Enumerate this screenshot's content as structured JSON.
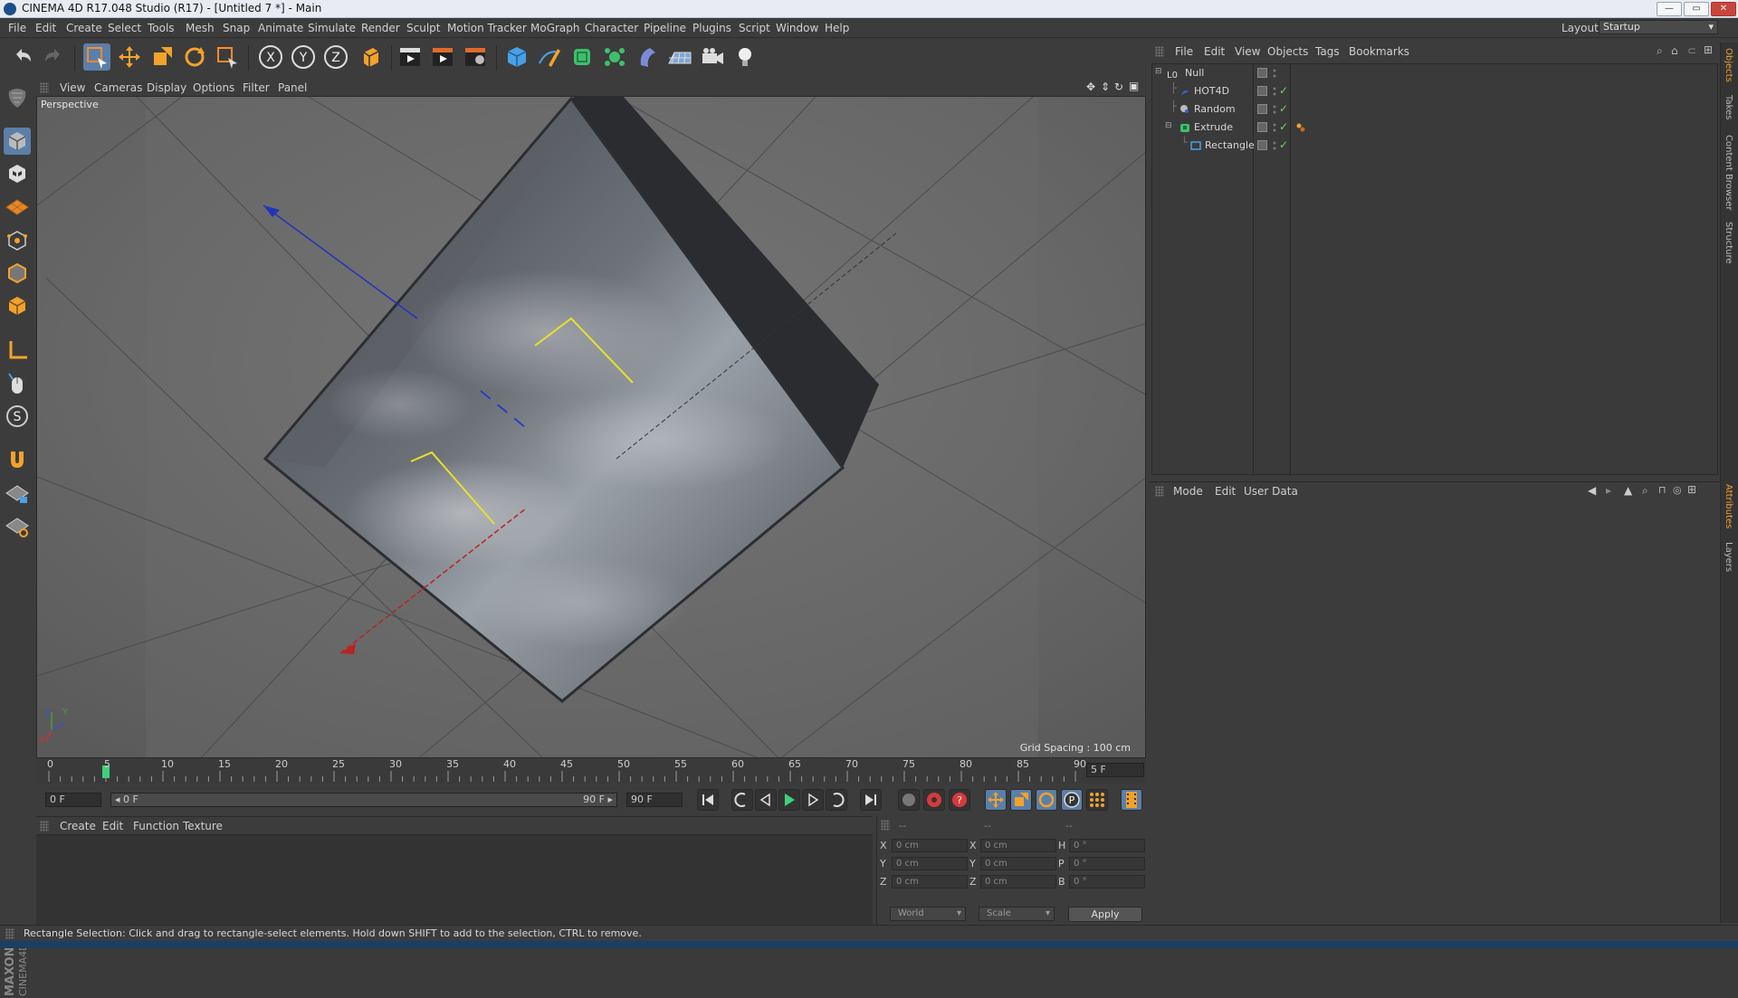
{
  "window": {
    "title": "CINEMA 4D R17.048 Studio (R17) - [Untitled 7 *] - Main",
    "minimize": "—",
    "maximize": "▭",
    "close": "✕"
  },
  "menu": {
    "items": [
      "File",
      "Edit",
      "Create",
      "Select",
      "Tools",
      "Mesh",
      "Snap",
      "Animate",
      "Simulate",
      "Render",
      "Sculpt",
      "Motion Tracker",
      "MoGraph",
      "Character",
      "Pipeline",
      "Plugins",
      "Script",
      "Window",
      "Help"
    ],
    "layout_label": "Layout:",
    "layout_value": "Startup"
  },
  "viewport": {
    "menu": [
      "View",
      "Cameras",
      "Display",
      "Options",
      "Filter",
      "Panel"
    ],
    "camera_label": "Perspective",
    "grid_spacing": "Grid Spacing : 100 cm",
    "axis_labels": {
      "y": "Y",
      "z": "Z",
      "x": "X"
    }
  },
  "timeline": {
    "ticks": [
      "0",
      "5",
      "10",
      "15",
      "20",
      "25",
      "30",
      "35",
      "40",
      "45",
      "50",
      "55",
      "60",
      "65",
      "70",
      "75",
      "80",
      "85",
      "90"
    ],
    "current_frame_display": "5 F",
    "start_field": "0 F",
    "range_start": "◂ 0 F",
    "range_end": "90 F ▸",
    "end_field": "90 F"
  },
  "material_manager": {
    "menu": [
      "Create",
      "Edit",
      "Function",
      "Texture"
    ]
  },
  "coordinates": {
    "headers": [
      "--",
      "--",
      "--"
    ],
    "rows": [
      {
        "a_label": "X",
        "a_value": "0 cm",
        "b_label": "X",
        "b_value": "0 cm",
        "c_label": "H",
        "c_value": "0 °"
      },
      {
        "a_label": "Y",
        "a_value": "0 cm",
        "b_label": "Y",
        "b_value": "0 cm",
        "c_label": "P",
        "c_value": "0 °"
      },
      {
        "a_label": "Z",
        "a_value": "0 cm",
        "b_label": "Z",
        "b_value": "0 cm",
        "c_label": "B",
        "c_value": "0 °"
      }
    ],
    "space": "World",
    "mode": "Scale",
    "apply": "Apply"
  },
  "status": "Rectangle Selection: Click and drag to rectangle-select elements. Hold down SHIFT to add to the selection, CTRL to remove.",
  "object_manager": {
    "menu": [
      "File",
      "Edit",
      "View",
      "Objects",
      "Tags",
      "Bookmarks"
    ],
    "objects": [
      {
        "name": "Null",
        "icon": "null-icon",
        "color": "#d8d8d8"
      },
      {
        "name": "HOT4D",
        "icon": "hot4d-icon",
        "color": "#d8d8d8"
      },
      {
        "name": "Random",
        "icon": "random-effector-icon",
        "color": "#d8d8d8"
      },
      {
        "name": "Extrude",
        "icon": "extrude-icon",
        "color": "#d8d8d8"
      },
      {
        "name": "Rectangle",
        "icon": "rectangle-spline-icon",
        "color": "#d8d8d8"
      }
    ]
  },
  "attribute_manager": {
    "menu": [
      "Mode",
      "Edit",
      "User Data"
    ]
  },
  "side_tabs": [
    "Objects",
    "Takes",
    "Content Browser",
    "Structure",
    "Attributes",
    "Layers"
  ],
  "brand": {
    "maxon": "MAXON",
    "product": "CINEMA4D"
  },
  "colors": {
    "accent_active": "#5b7fa8",
    "orange": "#f0a030",
    "check_green": "#6fd06f"
  }
}
